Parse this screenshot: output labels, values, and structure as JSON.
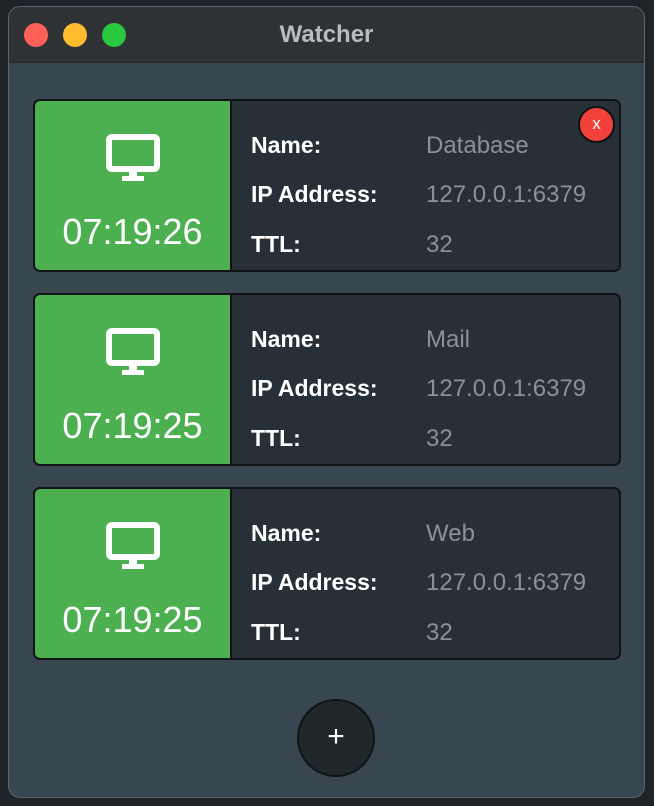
{
  "window": {
    "title": "Watcher",
    "traffic_lights": {
      "close_color": "#fe5f57",
      "minimize_color": "#febc2e",
      "maximize_color": "#28c840"
    }
  },
  "colors": {
    "status_ok": "#4caf50",
    "remove_button": "#f2403a",
    "card_background": "#263036",
    "window_background": "#37464f"
  },
  "labels": {
    "name": "Name:",
    "ip": "IP Address:",
    "ttl": "TTL:"
  },
  "watchers": [
    {
      "time": "07:19:26",
      "name": "Database",
      "ip": "127.0.0.1:6379",
      "ttl": "32",
      "icon": "monitor-icon",
      "status_color": "#4caf50",
      "show_remove": true
    },
    {
      "time": "07:19:25",
      "name": "Mail",
      "ip": "127.0.0.1:6379",
      "ttl": "32",
      "icon": "monitor-icon",
      "status_color": "#4caf50",
      "show_remove": false
    },
    {
      "time": "07:19:25",
      "name": "Web",
      "ip": "127.0.0.1:6379",
      "ttl": "32",
      "icon": "monitor-icon",
      "status_color": "#4caf50",
      "show_remove": false
    }
  ],
  "remove_button_label": "x",
  "add_button_label": "+"
}
